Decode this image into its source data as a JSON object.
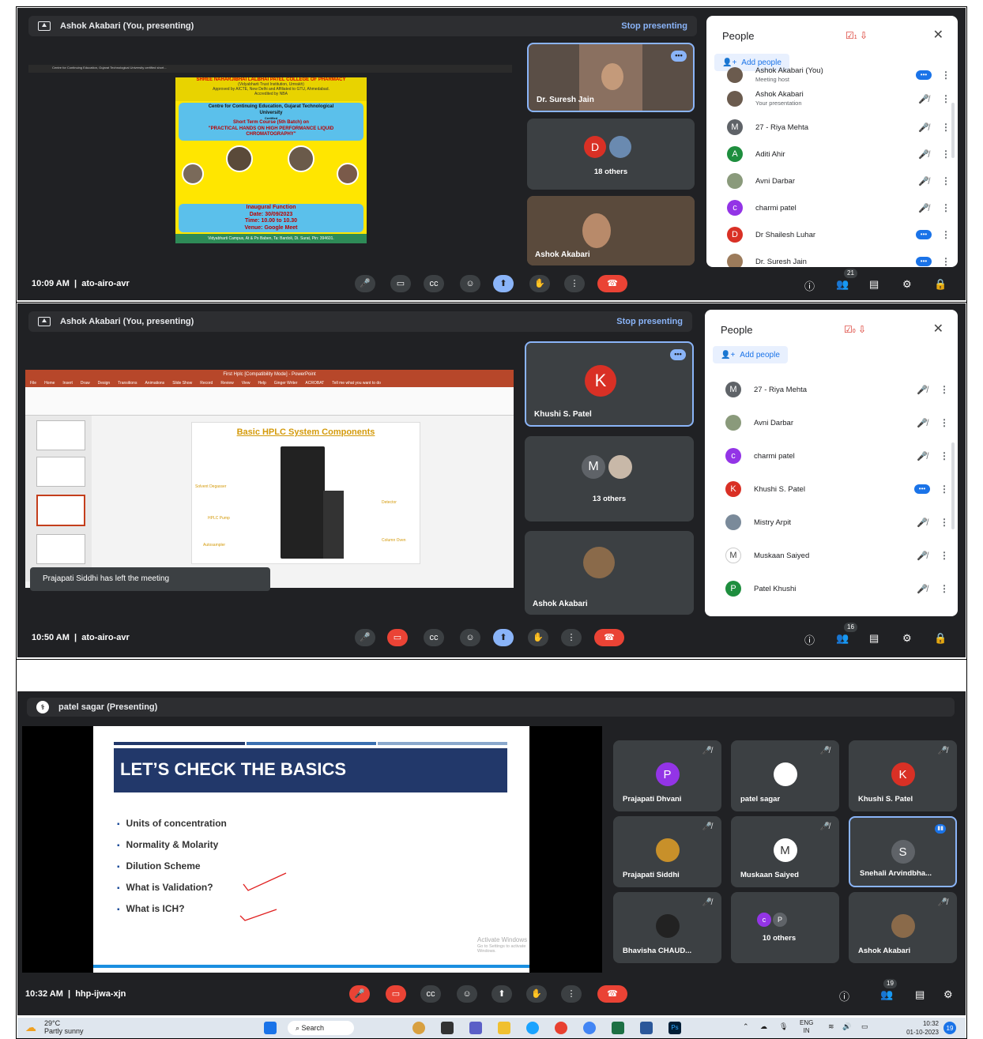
{
  "panel1": {
    "presenter": "Ashok Akabari (You, presenting)",
    "stop_label": "Stop presenting",
    "browser_tab": "Centre for Continuing Education, Gujarat Technological University certified short...",
    "poster": {
      "college": "SHREE NAHARJIBHAI LALBHAI PATEL COLLEGE OF PHARMACY",
      "college_sub1": "(Vidyabharti Trust Institution, Umrakh)",
      "college_sub2": "Approved by AICTE, New Delhi and Affiliated to GTU, Ahmedabad.",
      "college_sub3": "Accredited by NBA",
      "box1_l1": "Centre for Continuing Education, Gujarat Technological",
      "box1_l2": "University",
      "box1_l3": "Certified",
      "box1_l4": "Short Term Course (5th Batch) on",
      "box1_l5": "\"PRACTICAL HANDS ON HIGH PERFORMANCE LIQUID",
      "box1_l6": "CHROMATOGRAPHY\"",
      "box2_l1": "Inaugural Function",
      "box2_l2": "Date: 30/09/2023",
      "box2_l3": "Time: 10.00 to 10.30",
      "box2_l4": "Venue: Google Meet",
      "footer": "Vidyabharti Campus, At & Po Baben, Ta: Bardoli, Di. Surat, Pin: 394601."
    },
    "tiles": [
      "Dr. Suresh Jain",
      "18 others",
      "Ashok Akabari"
    ],
    "others_initial": "D",
    "people_title": "People",
    "hand_count": "1",
    "add_people": "Add people",
    "rows": [
      {
        "name": "Ashok Akabari (You)",
        "sub": "Meeting host",
        "initial": "",
        "color": "#6b5b4e"
      },
      {
        "name": "Ashok Akabari",
        "sub": "Your presentation",
        "initial": "",
        "color": "#6b5b4e"
      },
      {
        "name": "27 - Riya Mehta",
        "sub": "",
        "initial": "M",
        "color": "#5f6368"
      },
      {
        "name": "Aditi Ahir",
        "sub": "",
        "initial": "A",
        "color": "#1e8e3e"
      },
      {
        "name": "Avni Darbar",
        "sub": "",
        "initial": "",
        "color": "#8a9a7b"
      },
      {
        "name": "charmi patel",
        "sub": "",
        "initial": "c",
        "color": "#9334e6"
      },
      {
        "name": "Dr Shailesh Luhar",
        "sub": "",
        "initial": "D",
        "color": "#d93025"
      },
      {
        "name": "Dr. Suresh Jain",
        "sub": "",
        "initial": "",
        "color": "#9c7b5b"
      }
    ],
    "time": "10:09 AM",
    "code": "ato-airo-avr",
    "people_count": "21"
  },
  "panel2": {
    "presenter": "Ashok Akabari (You, presenting)",
    "stop_label": "Stop presenting",
    "ppt_title": "First Hplc [Compatibility Mode] - PowerPoint",
    "ppt_tabs": [
      "File",
      "Home",
      "Insert",
      "Draw",
      "Design",
      "Transitions",
      "Animations",
      "Slide Show",
      "Record",
      "Review",
      "View",
      "Help",
      "Ginger Writer",
      "ACROBAT",
      "Tell me what you want to do"
    ],
    "slide_title": "Basic HPLC System Components",
    "labels": [
      "Solvent Degasser",
      "HPLC Pump",
      "Autosampler",
      "Detector",
      "Column Oven"
    ],
    "toast": "Prajapati Siddhi has left the meeting",
    "tiles": [
      "Khushi S. Patel",
      "13 others",
      "Ashok Akabari"
    ],
    "k_initial": "K",
    "m_initial": "M",
    "people_title": "People",
    "hand_count": "0",
    "add_people": "Add people",
    "rows": [
      {
        "name": "27 - Riya Mehta",
        "initial": "M",
        "color": "#5f6368"
      },
      {
        "name": "Avni Darbar",
        "initial": "",
        "color": "#8a9a7b"
      },
      {
        "name": "charmi patel",
        "initial": "c",
        "color": "#9334e6"
      },
      {
        "name": "Khushi S. Patel",
        "initial": "K",
        "color": "#d93025"
      },
      {
        "name": "Mistry Arpit",
        "initial": "",
        "color": "#7a8a9a"
      },
      {
        "name": "Muskaan Saiyed",
        "initial": "M",
        "color": "#ffffff"
      },
      {
        "name": "Patel Khushi",
        "initial": "P",
        "color": "#1e8e3e"
      }
    ],
    "time": "10:50 AM",
    "code": "ato-airo-avr",
    "people_count": "16"
  },
  "panel3": {
    "presenter": "patel sagar (Presenting)",
    "slide_heading": "LET’S CHECK THE BASICS",
    "bullets": [
      "Units of concentration",
      "Normality & Molarity",
      "Dilution Scheme",
      "What is Validation?",
      "What is ICH?"
    ],
    "watermark1": "Activate Windows",
    "watermark2": "Go to Settings to activate Windows.",
    "tiles": [
      {
        "name": "Prajapati Dhvani",
        "initial": "P",
        "color": "#9334e6"
      },
      {
        "name": "patel sagar",
        "initial": "",
        "color": "#ffffff"
      },
      {
        "name": "Khushi S. Patel",
        "initial": "K",
        "color": "#d93025"
      },
      {
        "name": "Prajapati Siddhi",
        "initial": "",
        "color": "#c8902a"
      },
      {
        "name": "Muskaan Saiyed",
        "initial": "M",
        "color": "#ffffff"
      },
      {
        "name": "Snehali Arvindbha...",
        "initial": "S",
        "color": "#5f6368"
      },
      {
        "name": "Bhavisha CHAUD...",
        "initial": "",
        "color": "#222222"
      },
      {
        "name": "10 others",
        "initial": "",
        "color": "#3c4043"
      },
      {
        "name": "Ashok Akabari",
        "initial": "",
        "color": "#8a6a4a"
      }
    ],
    "others_initials": [
      "c",
      "P"
    ],
    "time": "10:32 AM",
    "code": "hhp-ijwa-xjn",
    "people_count": "19"
  },
  "taskbar": {
    "temp": "29°C",
    "weather": "Partly sunny",
    "search": "Search",
    "lang1": "ENG",
    "lang2": "IN",
    "clock_time": "10:32",
    "clock_date": "01-10-2023",
    "notif": "19"
  }
}
